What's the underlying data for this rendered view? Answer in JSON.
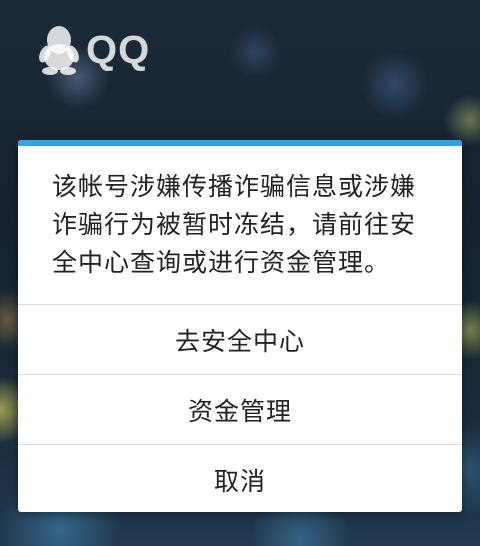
{
  "app": {
    "name": "QQ",
    "logo_icon": "qq-penguin-icon"
  },
  "dialog": {
    "accent_color": "#2ea3e6",
    "message": "该帐号涉嫌传播诈骗信息或涉嫌诈骗行为被暂时冻结，请前往安全中心查询或进行资金管理。",
    "options": [
      {
        "label": "去安全中心"
      },
      {
        "label": "资金管理"
      },
      {
        "label": "取消"
      }
    ]
  }
}
